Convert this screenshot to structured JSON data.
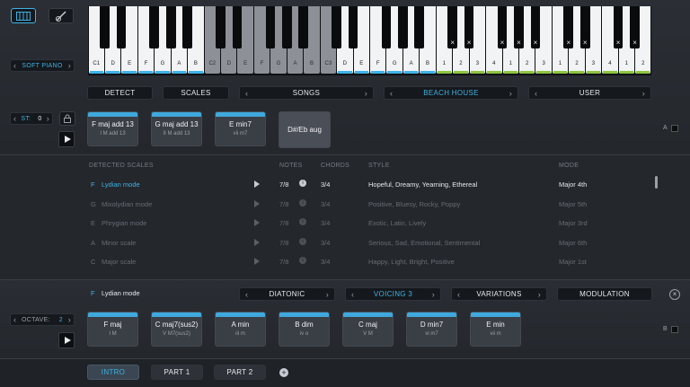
{
  "left": {
    "instrument": "SOFT PIANO",
    "st_label": "ST:",
    "st_value": "0",
    "octave_label": "OCTAVE:",
    "octave_value": "2"
  },
  "keyboard": {
    "white_labels": [
      "C1",
      "D",
      "E",
      "F",
      "G",
      "A",
      "B",
      "C2",
      "D",
      "E",
      "F",
      "G",
      "A",
      "B",
      "C3",
      "D",
      "E",
      "F",
      "G",
      "A",
      "B",
      "1",
      "2",
      "3",
      "4",
      "1",
      "2",
      "3",
      "1",
      "2",
      "3",
      "4",
      "1",
      "2"
    ]
  },
  "nav": {
    "detect": "DETECT",
    "scales": "SCALES",
    "songs": "SONGS",
    "beach_house": "BEACH HOUSE",
    "user": "USER"
  },
  "top_chords": [
    {
      "name": "F maj add 13",
      "roman": "I M add 13"
    },
    {
      "name": "G maj add 13",
      "roman": "II M add 13"
    },
    {
      "name": "E min7",
      "roman": "vii m7"
    },
    {
      "name": "D#/Eb aug",
      "roman": ""
    }
  ],
  "slot_a": "A",
  "slot_b": "B",
  "scales_table": {
    "headers": {
      "scales": "DETECTED SCALES",
      "notes": "NOTES",
      "chords": "CHORDS",
      "style": "STYLE",
      "mode": "MODE"
    },
    "rows": [
      {
        "key": "F",
        "name": "Lydian mode",
        "notes": "7/8",
        "chords": "3/4",
        "style": "Hopeful, Dreamy, Yearning, Ethereal",
        "mode": "Major  4th",
        "active": true
      },
      {
        "key": "G",
        "name": "Mixolydian mode",
        "notes": "7/8",
        "chords": "3/4",
        "style": "Positive, Bluesy, Rocky, Poppy",
        "mode": "Major  5th",
        "active": false
      },
      {
        "key": "E",
        "name": "Phrygian mode",
        "notes": "7/8",
        "chords": "3/4",
        "style": "Exotic, Latin, Lively",
        "mode": "Major  3rd",
        "active": false
      },
      {
        "key": "A",
        "name": "Minor scale",
        "notes": "7/8",
        "chords": "3/4",
        "style": "Serious, Sad, Emotional, Sentimental",
        "mode": "Major  6th",
        "active": false
      },
      {
        "key": "C",
        "name": "Major scale",
        "notes": "7/8",
        "chords": "3/4",
        "style": "Happy, Light, Bright, Positive",
        "mode": "Major  1st",
        "active": false
      }
    ]
  },
  "bottom": {
    "scale_key": "F",
    "scale_name": "Lydian mode",
    "diatonic": "DIATONIC",
    "voicing": "VOICING 3",
    "variations": "VARIATIONS",
    "modulation": "MODULATION"
  },
  "bottom_chords": [
    {
      "name": "F maj",
      "roman": "I M"
    },
    {
      "name": "C maj7(sus2)",
      "roman": "V M7(sus2)"
    },
    {
      "name": "A min",
      "roman": "iii m"
    },
    {
      "name": "B dim",
      "roman": "iv o"
    },
    {
      "name": "C maj",
      "roman": "V M"
    },
    {
      "name": "D min7",
      "roman": "vi m7"
    },
    {
      "name": "E min",
      "roman": "vii m"
    }
  ],
  "parts": {
    "intro": "INTRO",
    "part1": "PART 1",
    "part2": "PART 2"
  },
  "colors": {
    "accent": "#3fb3e6",
    "bar_green": "#8cc63f"
  }
}
